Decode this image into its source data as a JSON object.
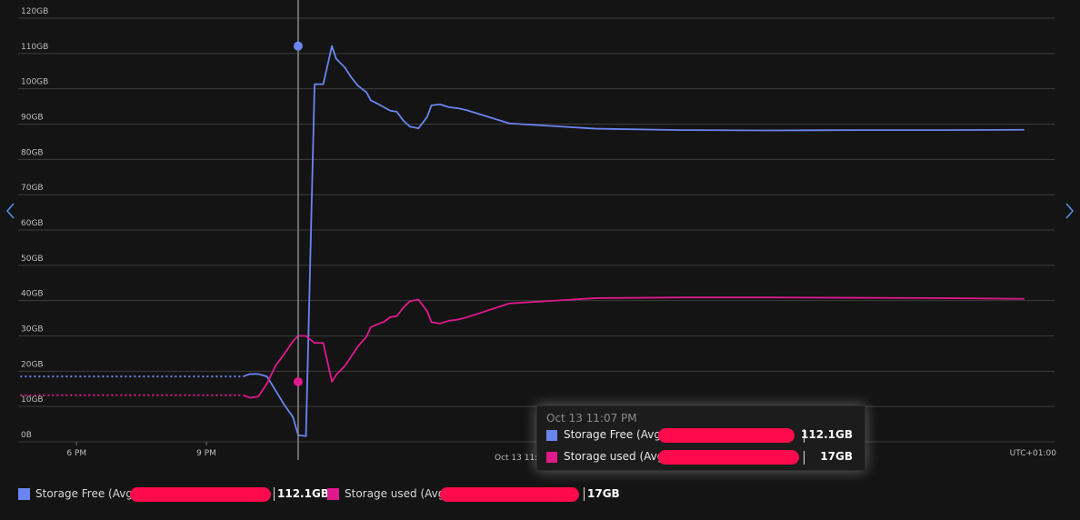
{
  "colors": {
    "free": "#6b85f0",
    "used": "#e0198d",
    "redaction": "#ff0a4d",
    "grid": "#3c3c3c",
    "cursor": "#8a8a8a"
  },
  "timezone": "UTC+01:00",
  "cursor_label": "Oct 13 11:",
  "tooltip": {
    "time": "Oct 13 11:07 PM",
    "rows": [
      {
        "label": "Storage Free (Avg),",
        "value": "112.1GB"
      },
      {
        "label": "Storage used (Avg),",
        "value": "17GB"
      }
    ]
  },
  "legend": [
    {
      "label": "Storage Free (Avg),",
      "value": "112.1GB"
    },
    {
      "label": "Storage used (Avg),",
      "value": "17GB"
    }
  ],
  "nav": {
    "left_icon": "chevron-left-icon",
    "right_icon": "chevron-right-icon"
  },
  "chart_data": {
    "type": "line",
    "title": "",
    "xlabel": "",
    "ylabel": "",
    "y_unit": "GB",
    "ylim": [
      0,
      120
    ],
    "y_ticks": [
      "0B",
      "10GB",
      "20GB",
      "30GB",
      "40GB",
      "50GB",
      "60GB",
      "70GB",
      "80GB",
      "90GB",
      "100GB",
      "110GB",
      "120GB"
    ],
    "x_unit": "hours",
    "xlim": [
      16.65,
      40.6
    ],
    "x_ticks": [
      {
        "value": 18,
        "label": "6 PM"
      },
      {
        "value": 21,
        "label": "9 PM"
      }
    ],
    "cursor_x": 23.12,
    "grid": true,
    "series": [
      {
        "name": "Storage Free (Avg)",
        "color": "#6b85f0",
        "x": [
          16.7,
          21.85,
          22.0,
          22.2,
          22.4,
          22.6,
          22.8,
          23.0,
          23.12,
          23.3,
          23.5,
          23.7,
          23.9,
          24.0,
          24.2,
          24.35,
          24.5,
          24.7,
          24.8,
          24.95,
          25.1,
          25.25,
          25.4,
          25.55,
          25.7,
          25.9,
          26.1,
          26.2,
          26.4,
          26.6,
          26.8,
          27.0,
          28.0,
          30.0,
          32.0,
          34.0,
          36.0,
          38.0,
          39.9
        ],
        "y": [
          18.5,
          18.5,
          19.2,
          19.2,
          18.5,
          14.5,
          10.5,
          7.0,
          1.9,
          1.6,
          101.3,
          101.3,
          112.1,
          108.5,
          106.0,
          103.2,
          100.9,
          99.0,
          96.7,
          95.8,
          94.8,
          93.8,
          93.5,
          91.0,
          89.3,
          88.8,
          92.0,
          95.3,
          95.6,
          94.8,
          94.5,
          94.0,
          90.2,
          88.7,
          88.3,
          88.2,
          88.3,
          88.3,
          88.4
        ]
      },
      {
        "name": "Storage used (Avg)",
        "color": "#e0198d",
        "x": [
          16.7,
          21.85,
          22.0,
          22.2,
          22.4,
          22.6,
          22.8,
          23.0,
          23.12,
          23.3,
          23.5,
          23.7,
          23.9,
          24.0,
          24.2,
          24.35,
          24.5,
          24.7,
          24.8,
          24.95,
          25.1,
          25.25,
          25.4,
          25.55,
          25.7,
          25.9,
          26.1,
          26.2,
          26.4,
          26.6,
          26.8,
          27.0,
          28.0,
          30.0,
          32.0,
          34.0,
          36.0,
          38.0,
          39.9
        ],
        "y": [
          13.2,
          13.2,
          12.5,
          12.8,
          16.5,
          21.6,
          24.9,
          28.5,
          30.0,
          30.0,
          28.0,
          28.0,
          17.0,
          19.0,
          21.5,
          24.2,
          27.0,
          29.8,
          32.5,
          33.3,
          34.0,
          35.3,
          35.6,
          38.0,
          39.8,
          40.3,
          37.0,
          33.9,
          33.5,
          34.3,
          34.6,
          35.2,
          39.2,
          40.7,
          40.9,
          40.9,
          40.8,
          40.7,
          40.5
        ]
      }
    ],
    "highlight_points": [
      {
        "series": "Storage Free (Avg)",
        "x": 23.12,
        "y": 112.1
      },
      {
        "series": "Storage used (Avg)",
        "x": 23.12,
        "y": 17
      }
    ]
  }
}
